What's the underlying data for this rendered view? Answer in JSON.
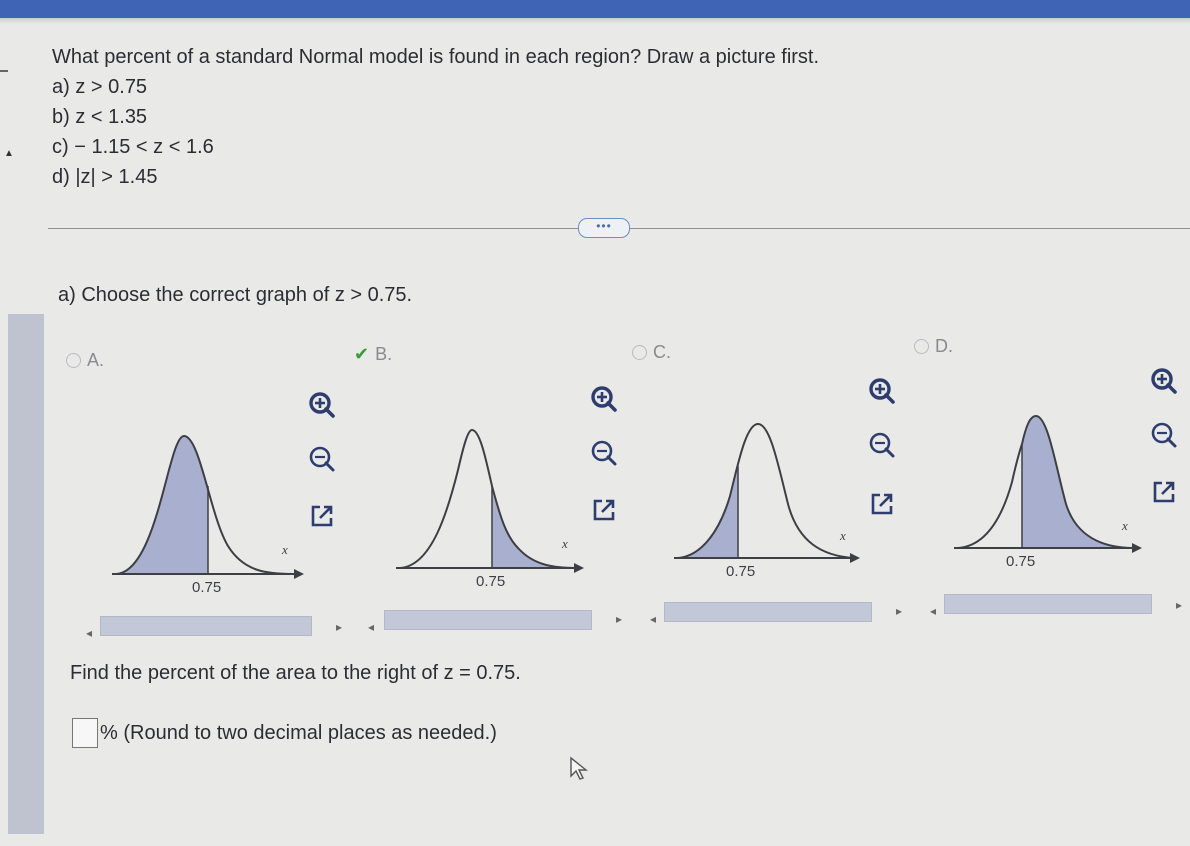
{
  "question": {
    "prompt": "What percent of a standard Normal model is found in each region? Draw a picture first.",
    "parts": [
      "a) z > 0.75",
      "b) z < 1.35",
      "c) − 1.15 < z < 1.6",
      "d) |z| > 1.45"
    ]
  },
  "more_button": "•••",
  "subquestion": "a) Choose the correct graph of z > 0.75.",
  "options": [
    {
      "letter": "A.",
      "selected": false,
      "tick_label": "0.75",
      "axis_label": "x",
      "shaded": "left"
    },
    {
      "letter": "B.",
      "selected": true,
      "tick_label": "0.75",
      "axis_label": "x",
      "shaded": "right"
    },
    {
      "letter": "C.",
      "selected": false,
      "tick_label": "0.75",
      "axis_label": "x",
      "shaded": "left-small"
    },
    {
      "letter": "D.",
      "selected": false,
      "tick_label": "0.75",
      "axis_label": "x",
      "shaded": "right-large"
    }
  ],
  "find_text": "Find the percent of the area to the right of z = 0.75.",
  "answer": {
    "value": "",
    "suffix": "% (Round to two decimal places as needed.)"
  },
  "colors": {
    "accent": "#3f63b5",
    "shade": "#a9afcf",
    "check": "#3b9b3b"
  }
}
